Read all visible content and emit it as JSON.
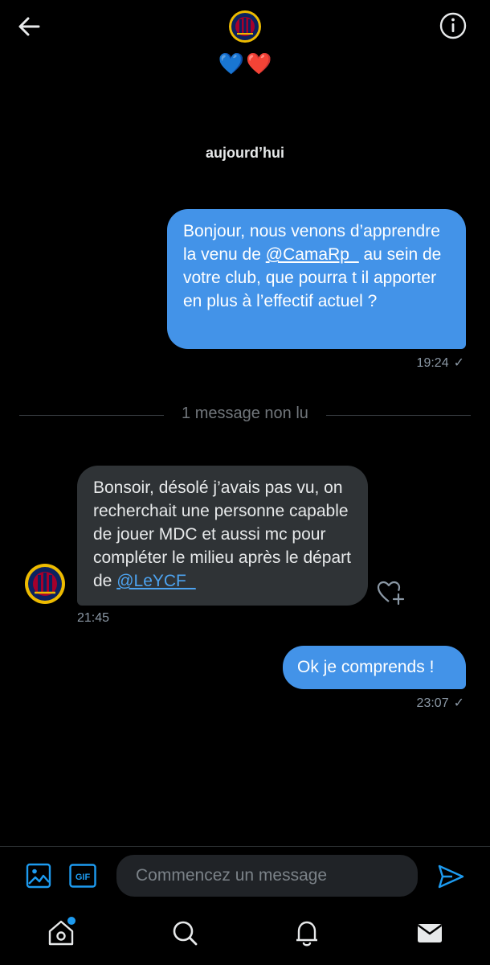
{
  "header": {
    "hearts": [
      "💙",
      "❤️"
    ]
  },
  "day_label": "aujourd’hui",
  "messages": [
    {
      "direction": "out",
      "text_before": "Bonjour, nous venons d’apprendre la venu de ",
      "mention": "@CamaRp_",
      "text_after": " au sein de votre club, que pourra t il apporter en plus à l’effectif actuel ?",
      "time": "19:24",
      "status": "✓"
    },
    {
      "direction": "in",
      "text_before": "Bonsoir, désolé j’avais pas vu, on recherchait une personne capable de jouer MDC et aussi mc pour compléter le milieu après le départ de ",
      "mention": "@LeYCF_",
      "time": "21:45"
    },
    {
      "direction": "out",
      "text": "Ok je comprends !",
      "time": "23:07",
      "status": "✓"
    }
  ],
  "unread_divider": "1 message non lu",
  "composer": {
    "placeholder": "Commencez un message",
    "media_icon": "image-icon",
    "gif_label": "GIF",
    "send_icon": "send-icon"
  },
  "nav": {
    "items": [
      "home-icon",
      "search-icon",
      "bell-icon",
      "mail-icon"
    ],
    "accent": "#1d9bf0"
  },
  "colors": {
    "outgoing_bubble": "#4393e8",
    "incoming_bubble": "#2f3336",
    "background": "#000000",
    "club_navy": "#0b2260",
    "club_red": "#a5002c",
    "club_gold": "#edbb00"
  }
}
